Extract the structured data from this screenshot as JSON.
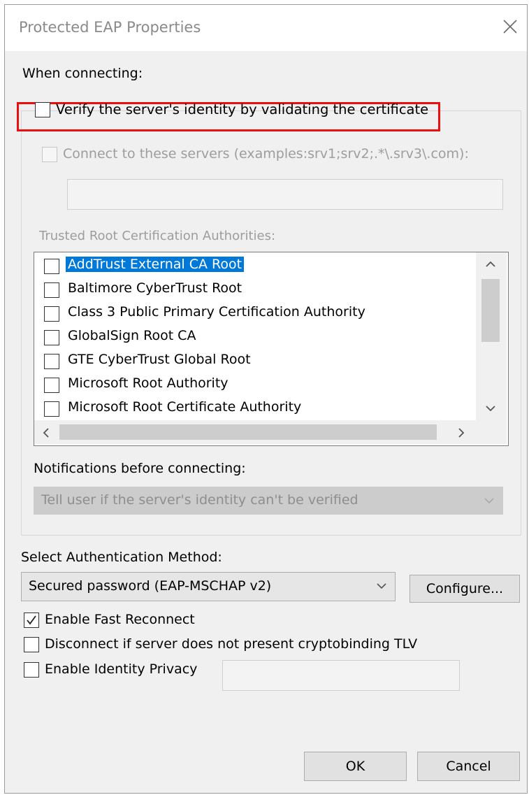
{
  "window": {
    "title": "Protected EAP Properties",
    "close_icon": "close-icon"
  },
  "connecting": {
    "header": "When connecting:",
    "verify_label": "Verify the server's identity by validating the certificate",
    "verify_checked": false,
    "connect_servers_label": "Connect to these servers (examples:srv1;srv2;.*\\.srv3\\.com):",
    "servers_value": ""
  },
  "trusted_ca": {
    "label": "Trusted Root Certification Authorities:",
    "items": [
      {
        "label": "AddTrust External CA Root",
        "checked": false,
        "selected": true
      },
      {
        "label": "Baltimore CyberTrust Root",
        "checked": false,
        "selected": false
      },
      {
        "label": "Class 3 Public Primary Certification Authority",
        "checked": false,
        "selected": false
      },
      {
        "label": "GlobalSign Root CA",
        "checked": false,
        "selected": false
      },
      {
        "label": "GTE CyberTrust Global Root",
        "checked": false,
        "selected": false
      },
      {
        "label": "Microsoft Root Authority",
        "checked": false,
        "selected": false
      },
      {
        "label": "Microsoft Root Certificate Authority",
        "checked": false,
        "selected": false
      }
    ]
  },
  "notifications": {
    "label": "Notifications before connecting:",
    "selected": "Tell user if the server's identity can't be verified"
  },
  "auth": {
    "label": "Select Authentication Method:",
    "selected": "Secured password (EAP-MSCHAP v2)",
    "configure_label": "Configure..."
  },
  "options": {
    "fast_reconnect": {
      "label": "Enable Fast Reconnect",
      "checked": true
    },
    "cryptobinding": {
      "label": "Disconnect if server does not present cryptobinding TLV",
      "checked": false
    },
    "identity_privacy": {
      "label": "Enable Identity Privacy",
      "checked": false,
      "value": ""
    }
  },
  "footer": {
    "ok_label": "OK",
    "cancel_label": "Cancel"
  },
  "colors": {
    "highlight": "#e81010",
    "selection": "#0078d7"
  }
}
